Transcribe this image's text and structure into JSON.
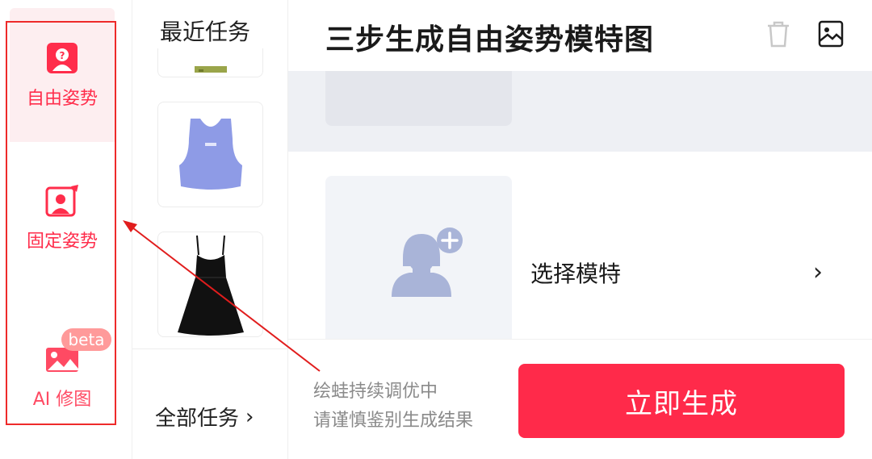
{
  "nav": {
    "items": [
      {
        "label": "自由姿势",
        "icon": "portrait-question-icon"
      },
      {
        "label": "固定姿势",
        "icon": "portrait-pin-icon"
      },
      {
        "label": "AI 修图",
        "icon": "image-icon",
        "badge": "beta"
      }
    ]
  },
  "recent": {
    "title": "最近任务",
    "items": [
      {
        "name": "green-garment-thumbnail"
      },
      {
        "name": "blue-tank-top-thumbnail"
      },
      {
        "name": "black-dress-thumbnail"
      }
    ],
    "all_tasks_label": "全部任务",
    "all_tasks_chevron": "›"
  },
  "main": {
    "title": "三步生成自由姿势模特图",
    "header_icons": [
      "trash-icon",
      "image-icon"
    ],
    "model_label": "选择模特",
    "model_chevron": "›",
    "notes": [
      "绘蛙持续调优中",
      "请谨慎鉴别生成结果"
    ],
    "generate_label": "立即生成"
  },
  "colors": {
    "accent": "#ff2a4a",
    "active_bg": "#fdeef0",
    "annotation": "#ee2a2a",
    "placeholder_avatar": "#a9b4d8"
  }
}
